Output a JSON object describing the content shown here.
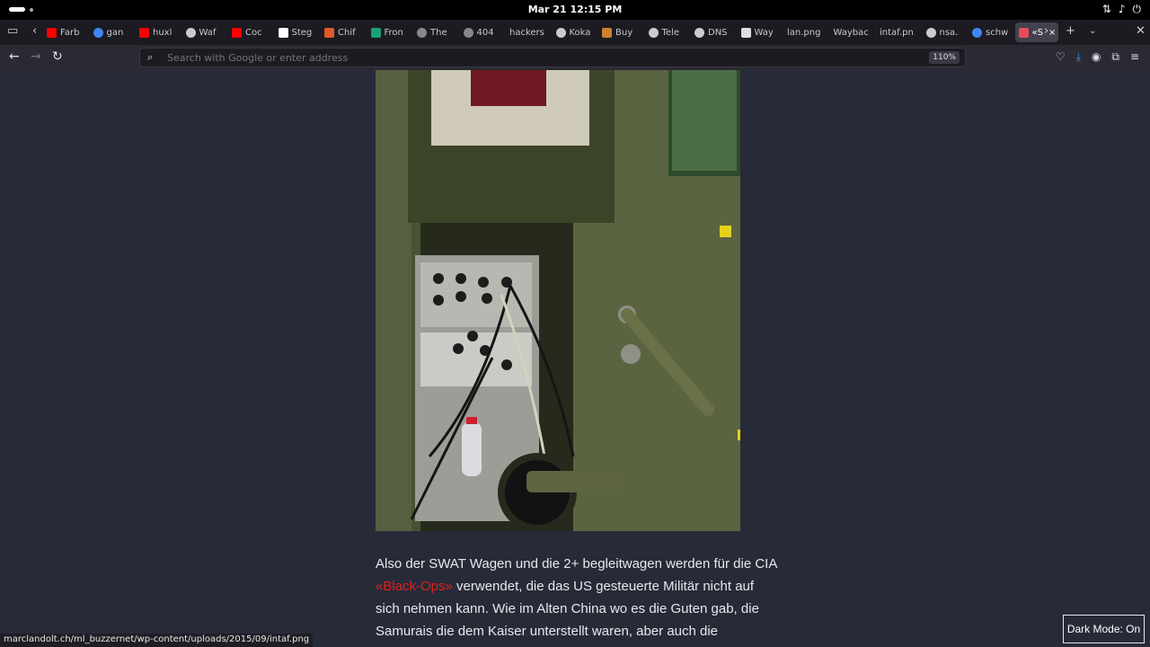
{
  "system": {
    "clock": "Mar 21  12:15 PM",
    "tray_icons": [
      "network-icon",
      "volume-icon",
      "power-icon"
    ]
  },
  "tabs": [
    {
      "label": "Farb",
      "icon": "youtube-icon",
      "color": "#ff0000"
    },
    {
      "label": "gan",
      "icon": "google-icon",
      "color": "#4285f4"
    },
    {
      "label": "huxl",
      "icon": "youtube-icon",
      "color": "#ff0000"
    },
    {
      "label": "Waf",
      "icon": "globe-icon",
      "color": "#cccccc"
    },
    {
      "label": "Coc",
      "icon": "youtube-icon",
      "color": "#ff0000"
    },
    {
      "label": "Steg",
      "icon": "wikipedia-icon",
      "color": "#ffffff"
    },
    {
      "label": "Chif",
      "icon": "mountain-icon",
      "color": "#e05a2b"
    },
    {
      "label": "Fron",
      "icon": "bookmark-icon",
      "color": "#1aa07a"
    },
    {
      "label": "The",
      "icon": "github-icon",
      "color": "#888888"
    },
    {
      "label": "404",
      "icon": "github-icon",
      "color": "#888888"
    },
    {
      "label": "hackers",
      "icon": "",
      "color": ""
    },
    {
      "label": "Koka",
      "icon": "globe-icon",
      "color": "#cccccc"
    },
    {
      "label": "Buy",
      "icon": "bag-icon",
      "color": "#d08030"
    },
    {
      "label": "Tele",
      "icon": "globe-icon",
      "color": "#cccccc"
    },
    {
      "label": "DNS",
      "icon": "globe-icon",
      "color": "#cccccc"
    },
    {
      "label": "Way",
      "icon": "document-icon",
      "color": "#dddddd"
    },
    {
      "label": "lan.png",
      "icon": "",
      "color": ""
    },
    {
      "label": "Waybac",
      "icon": "",
      "color": ""
    },
    {
      "label": "intaf.pn",
      "icon": "",
      "color": ""
    },
    {
      "label": "nsa.",
      "icon": "globe-icon",
      "color": "#cccccc"
    },
    {
      "label": "schw",
      "icon": "google-icon",
      "color": "#4285f4"
    },
    {
      "label": "«S",
      "icon": "site-icon",
      "color": "#e74c5c",
      "active": true
    }
  ],
  "navbar": {
    "url_placeholder": "Search with Google or enter address",
    "zoom": "110%"
  },
  "article": {
    "text_before_link": "Also der SWAT Wagen und die 2+ begleitwagen werden für die CIA ",
    "link": "«Black-Ops»",
    "text_after_link": " verwendet, die das US gesteuerte Militär nicht auf sich nehmen kann. Wie im Alten China wo es die Guten gab, die Samurais die dem Kaiser unterstellt waren, aber auch die schlechten, die",
    "link_color": "#e0201e"
  },
  "status_url": "marclandolt.ch/ml_buzzernet/wp-content/uploads/2015/09/intaf.png",
  "dark_mode_label": "Dark Mode: On",
  "colors": {
    "page_bg": "#272b38",
    "tabbar_bg": "#1c1b22",
    "navbar_bg": "#2b2a33"
  }
}
